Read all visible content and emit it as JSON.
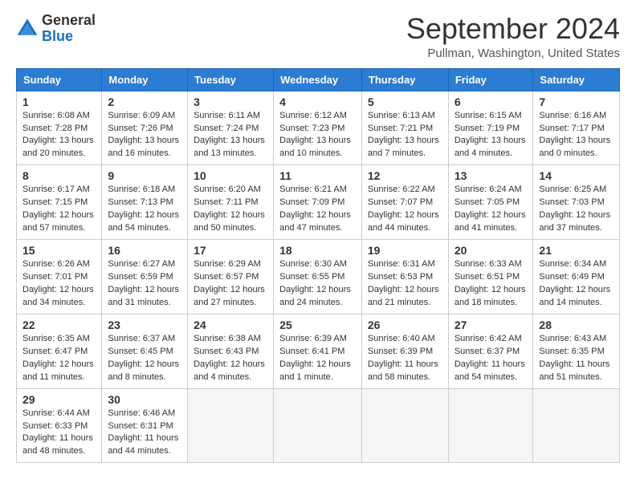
{
  "header": {
    "logo_line1": "General",
    "logo_line2": "Blue",
    "month_title": "September 2024",
    "location": "Pullman, Washington, United States"
  },
  "days_of_week": [
    "Sunday",
    "Monday",
    "Tuesday",
    "Wednesday",
    "Thursday",
    "Friday",
    "Saturday"
  ],
  "weeks": [
    [
      {
        "day": "1",
        "sunrise": "6:08 AM",
        "sunset": "7:28 PM",
        "daylight": "13 hours and 20 minutes."
      },
      {
        "day": "2",
        "sunrise": "6:09 AM",
        "sunset": "7:26 PM",
        "daylight": "13 hours and 16 minutes."
      },
      {
        "day": "3",
        "sunrise": "6:11 AM",
        "sunset": "7:24 PM",
        "daylight": "13 hours and 13 minutes."
      },
      {
        "day": "4",
        "sunrise": "6:12 AM",
        "sunset": "7:23 PM",
        "daylight": "13 hours and 10 minutes."
      },
      {
        "day": "5",
        "sunrise": "6:13 AM",
        "sunset": "7:21 PM",
        "daylight": "13 hours and 7 minutes."
      },
      {
        "day": "6",
        "sunrise": "6:15 AM",
        "sunset": "7:19 PM",
        "daylight": "13 hours and 4 minutes."
      },
      {
        "day": "7",
        "sunrise": "6:16 AM",
        "sunset": "7:17 PM",
        "daylight": "13 hours and 0 minutes."
      }
    ],
    [
      {
        "day": "8",
        "sunrise": "6:17 AM",
        "sunset": "7:15 PM",
        "daylight": "12 hours and 57 minutes."
      },
      {
        "day": "9",
        "sunrise": "6:18 AM",
        "sunset": "7:13 PM",
        "daylight": "12 hours and 54 minutes."
      },
      {
        "day": "10",
        "sunrise": "6:20 AM",
        "sunset": "7:11 PM",
        "daylight": "12 hours and 50 minutes."
      },
      {
        "day": "11",
        "sunrise": "6:21 AM",
        "sunset": "7:09 PM",
        "daylight": "12 hours and 47 minutes."
      },
      {
        "day": "12",
        "sunrise": "6:22 AM",
        "sunset": "7:07 PM",
        "daylight": "12 hours and 44 minutes."
      },
      {
        "day": "13",
        "sunrise": "6:24 AM",
        "sunset": "7:05 PM",
        "daylight": "12 hours and 41 minutes."
      },
      {
        "day": "14",
        "sunrise": "6:25 AM",
        "sunset": "7:03 PM",
        "daylight": "12 hours and 37 minutes."
      }
    ],
    [
      {
        "day": "15",
        "sunrise": "6:26 AM",
        "sunset": "7:01 PM",
        "daylight": "12 hours and 34 minutes."
      },
      {
        "day": "16",
        "sunrise": "6:27 AM",
        "sunset": "6:59 PM",
        "daylight": "12 hours and 31 minutes."
      },
      {
        "day": "17",
        "sunrise": "6:29 AM",
        "sunset": "6:57 PM",
        "daylight": "12 hours and 27 minutes."
      },
      {
        "day": "18",
        "sunrise": "6:30 AM",
        "sunset": "6:55 PM",
        "daylight": "12 hours and 24 minutes."
      },
      {
        "day": "19",
        "sunrise": "6:31 AM",
        "sunset": "6:53 PM",
        "daylight": "12 hours and 21 minutes."
      },
      {
        "day": "20",
        "sunrise": "6:33 AM",
        "sunset": "6:51 PM",
        "daylight": "12 hours and 18 minutes."
      },
      {
        "day": "21",
        "sunrise": "6:34 AM",
        "sunset": "6:49 PM",
        "daylight": "12 hours and 14 minutes."
      }
    ],
    [
      {
        "day": "22",
        "sunrise": "6:35 AM",
        "sunset": "6:47 PM",
        "daylight": "12 hours and 11 minutes."
      },
      {
        "day": "23",
        "sunrise": "6:37 AM",
        "sunset": "6:45 PM",
        "daylight": "12 hours and 8 minutes."
      },
      {
        "day": "24",
        "sunrise": "6:38 AM",
        "sunset": "6:43 PM",
        "daylight": "12 hours and 4 minutes."
      },
      {
        "day": "25",
        "sunrise": "6:39 AM",
        "sunset": "6:41 PM",
        "daylight": "12 hours and 1 minute."
      },
      {
        "day": "26",
        "sunrise": "6:40 AM",
        "sunset": "6:39 PM",
        "daylight": "11 hours and 58 minutes."
      },
      {
        "day": "27",
        "sunrise": "6:42 AM",
        "sunset": "6:37 PM",
        "daylight": "11 hours and 54 minutes."
      },
      {
        "day": "28",
        "sunrise": "6:43 AM",
        "sunset": "6:35 PM",
        "daylight": "11 hours and 51 minutes."
      }
    ],
    [
      {
        "day": "29",
        "sunrise": "6:44 AM",
        "sunset": "6:33 PM",
        "daylight": "11 hours and 48 minutes."
      },
      {
        "day": "30",
        "sunrise": "6:46 AM",
        "sunset": "6:31 PM",
        "daylight": "11 hours and 44 minutes."
      },
      null,
      null,
      null,
      null,
      null
    ]
  ]
}
